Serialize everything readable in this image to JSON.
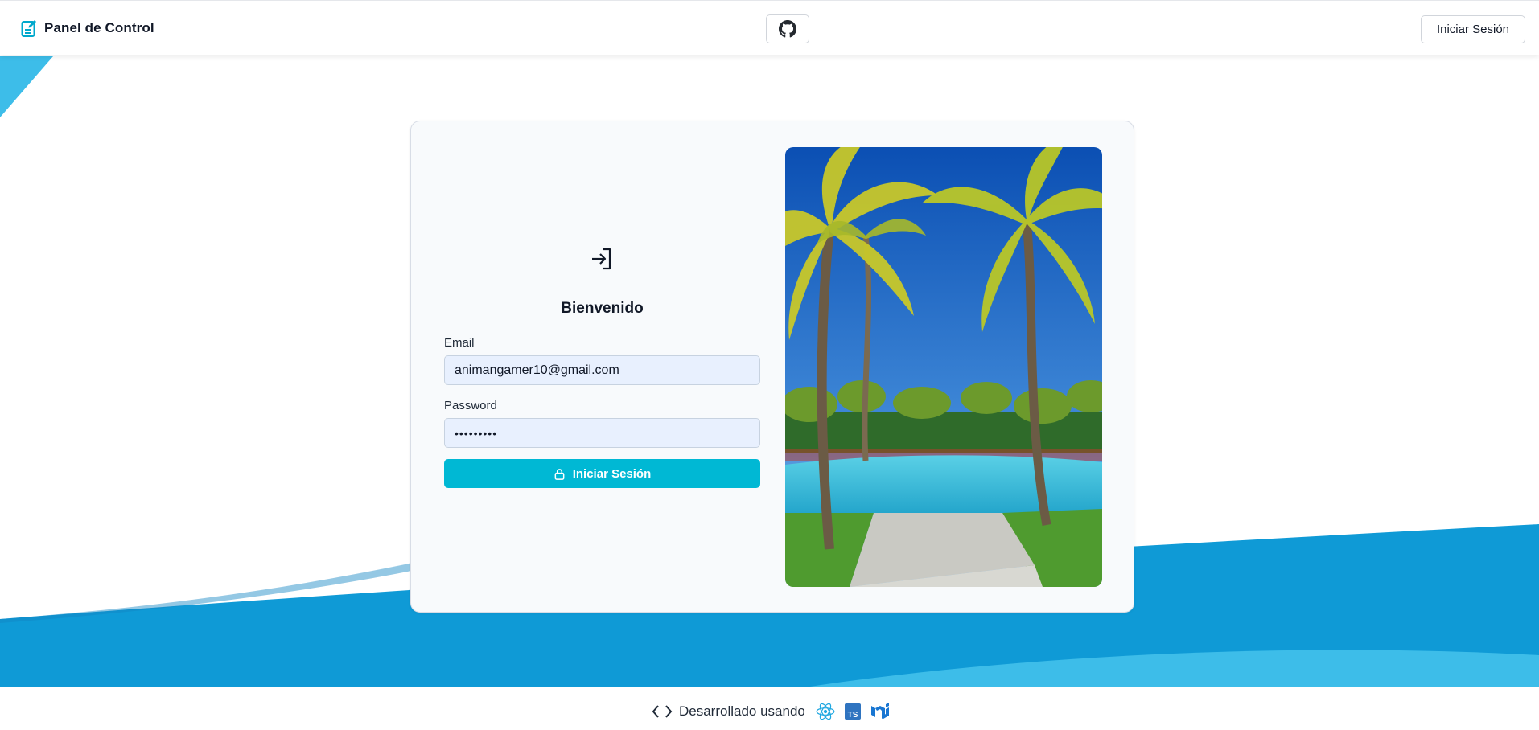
{
  "header": {
    "brand_title": "Panel de Control",
    "github_icon": "github-icon",
    "login_button": "Iniciar Sesión"
  },
  "login": {
    "icon": "login-arrow-icon",
    "title": "Bienvenido",
    "email_label": "Email",
    "email_value": "animangamer10@gmail.com",
    "password_label": "Password",
    "password_value": "•••••••••",
    "submit_label": "Iniciar Sesión",
    "submit_icon": "lock-icon"
  },
  "footer": {
    "text": "Desarrollado usando",
    "icons": [
      "code-icon",
      "react-icon",
      "typescript-icon",
      "mui-icon"
    ],
    "ts_text": "TS"
  },
  "colors": {
    "accent": "#00b8d4",
    "wave_dark": "#0f9ad6",
    "wave_light": "#3dbde9",
    "card_bg": "#f8fafc",
    "input_bg": "#e8f0fe"
  }
}
